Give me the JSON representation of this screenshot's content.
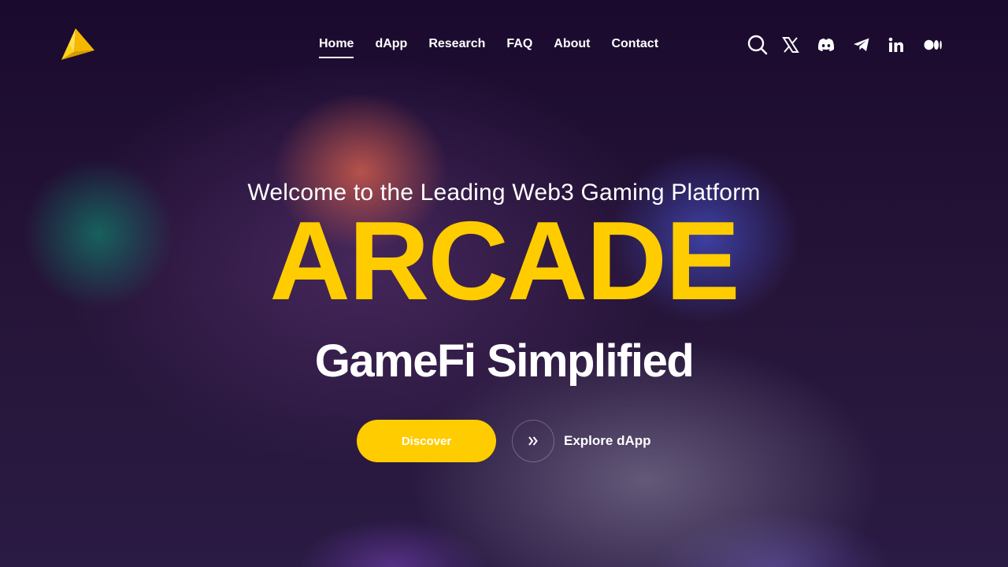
{
  "brand": {
    "logo_icon": "arcade-triangle-logo-icon",
    "accent_color": "#ffcc00"
  },
  "nav": {
    "items": [
      {
        "label": "Home",
        "active": true
      },
      {
        "label": "dApp"
      },
      {
        "label": "Research"
      },
      {
        "label": "FAQ"
      },
      {
        "label": "About"
      },
      {
        "label": "Contact"
      }
    ]
  },
  "header_icons": [
    "search-icon",
    "x-twitter-icon",
    "discord-icon",
    "telegram-icon",
    "linkedin-icon",
    "medium-icon"
  ],
  "hero": {
    "welcome": "Welcome to the Leading Web3 Gaming Platform",
    "title": "ARCADE",
    "subtitle": "GameFi Simplified",
    "discover_label": "Discover",
    "explore_label": "Explore dApp"
  }
}
